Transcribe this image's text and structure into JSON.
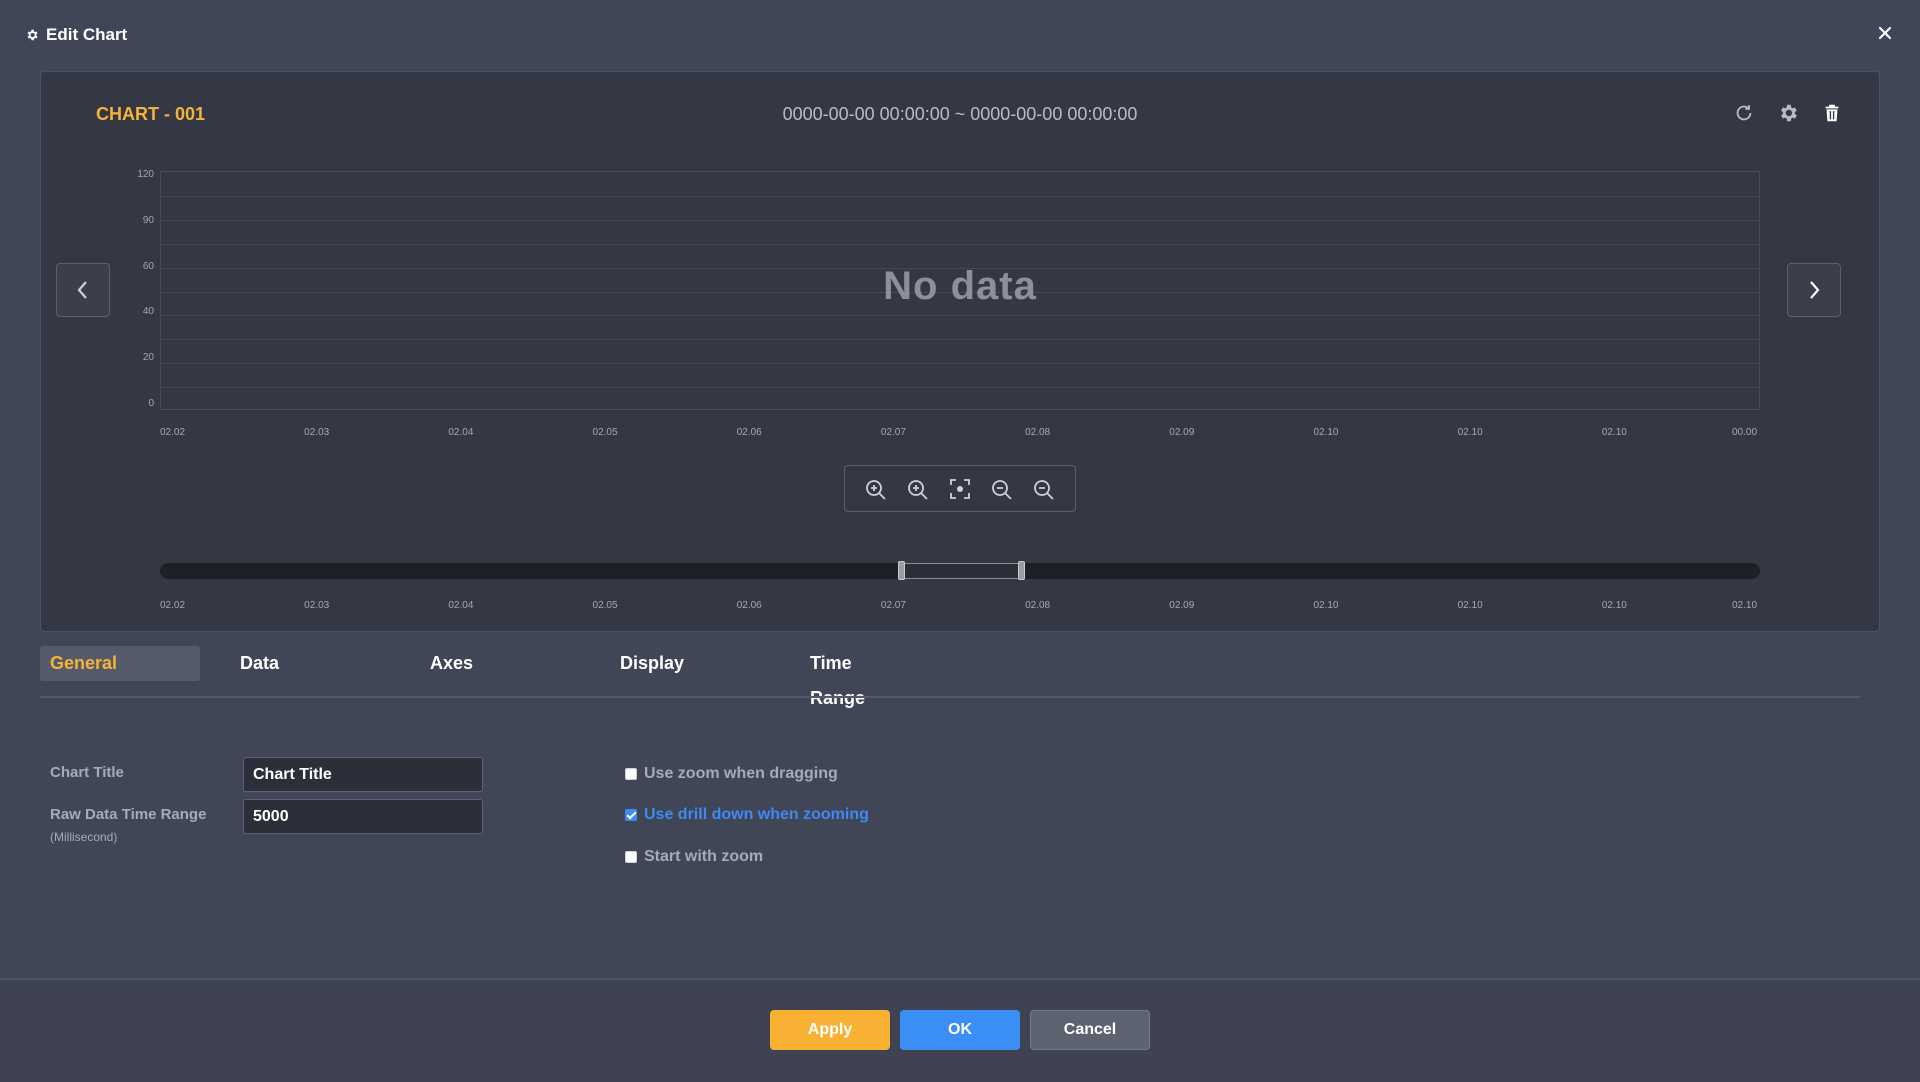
{
  "dialog": {
    "title": "Edit Chart",
    "title_icon": "gear-icon",
    "close_icon": "close-icon"
  },
  "chart": {
    "name": "CHART - 001",
    "time_range": "0000-00-00 00:00:00 ~ 0000-00-00 00:00:00",
    "no_data_text": "No data",
    "toolbar_icons": [
      "refresh-icon",
      "gear-icon",
      "trash-icon"
    ],
    "zoom_icons": [
      "zoom-in-4x-icon",
      "zoom-in-2x-icon",
      "focus-icon",
      "zoom-out-2x-icon",
      "zoom-out-4x-icon"
    ],
    "accent_color": "#f5b33b"
  },
  "chart_data": {
    "type": "line",
    "title": "",
    "y_ticks": [
      "120",
      "90",
      "60",
      "40",
      "20",
      "0"
    ],
    "x_ticks": [
      "02.02",
      "02.03",
      "02.04",
      "02.05",
      "02.06",
      "02.07",
      "02.08",
      "02.09",
      "02.10",
      "02.10",
      "02.10",
      "00.00"
    ],
    "navigator_ticks": [
      "02.02",
      "02.03",
      "02.04",
      "02.05",
      "02.06",
      "02.07",
      "02.08",
      "02.09",
      "02.10",
      "02.10",
      "02.10",
      "02.10"
    ],
    "series": [],
    "grid": true
  },
  "tabs": [
    {
      "label": "General",
      "active": true
    },
    {
      "label": "Data",
      "active": false
    },
    {
      "label": "Axes",
      "active": false
    },
    {
      "label": "Display",
      "active": false
    },
    {
      "label": "Time Range",
      "active": false
    }
  ],
  "general": {
    "chart_title_label": "Chart Title",
    "chart_title_value": "Chart Title",
    "raw_range_label": "Raw Data Time Range",
    "raw_range_unit": "(Millisecond)",
    "raw_range_value": "5000",
    "options": [
      {
        "label": "Use zoom when dragging",
        "checked": false
      },
      {
        "label": "Use drill down when zooming",
        "checked": true
      },
      {
        "label": "Start with zoom",
        "checked": false
      }
    ]
  },
  "footer": {
    "apply_label": "Apply",
    "ok_label": "OK",
    "cancel_label": "Cancel"
  }
}
